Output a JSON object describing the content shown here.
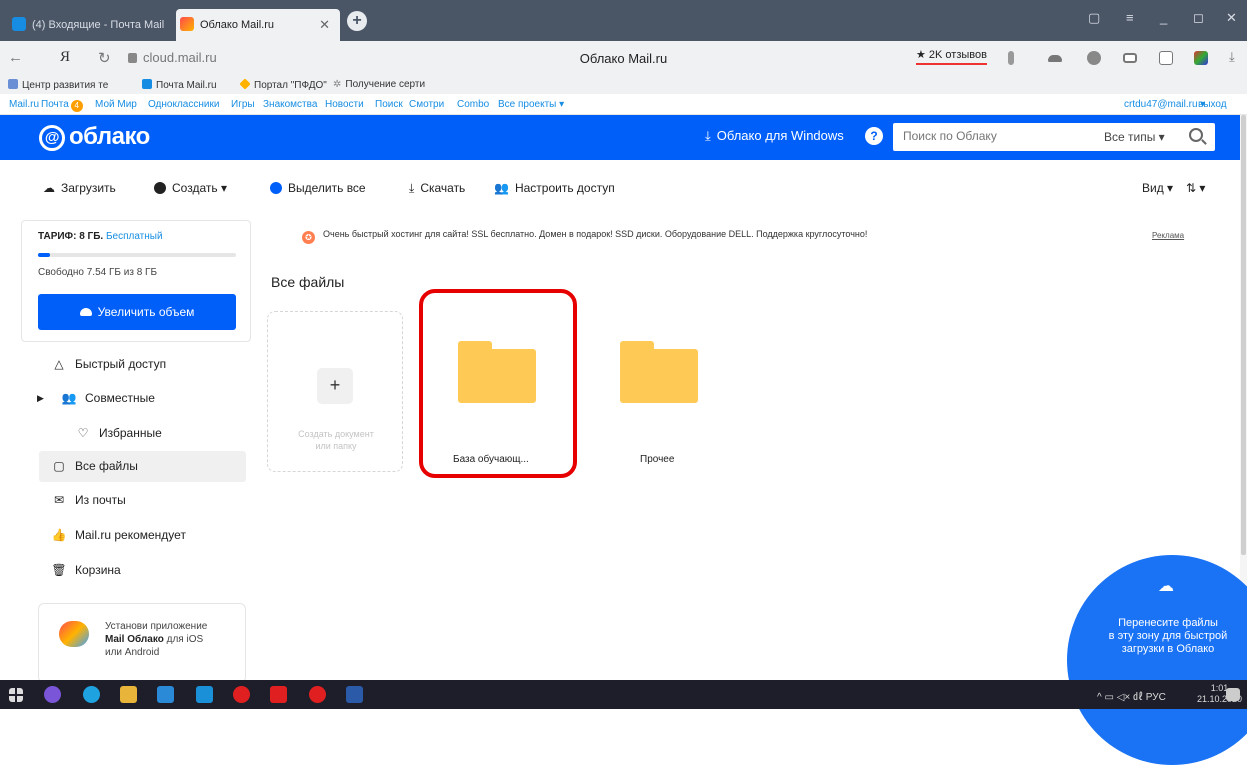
{
  "browser": {
    "tabs": [
      {
        "label": "(4) Входящие - Почта Mail",
        "active": false
      },
      {
        "label": "Облако Mail.ru",
        "active": true
      }
    ],
    "new_tab_symbol": "+",
    "window_controls": [
      "▢",
      "≡",
      "_",
      "◻",
      "✕"
    ],
    "url": "cloud.mail.ru",
    "page_title": "Облако Mail.ru",
    "reviews": "★ 2K отзывов",
    "nav": {
      "back": "←",
      "yandex": "Я",
      "reload": "↻"
    },
    "bookmarks": [
      "Центр развития те",
      "Почта Mail.ru",
      "Портал \"ПФДО\"",
      "Получение серти"
    ]
  },
  "portal": {
    "links": [
      "Mail.ru",
      "Почта",
      "Мой Мир",
      "Одноклассники",
      "Игры",
      "Знакомства",
      "Новости",
      "Поиск",
      "Смотри",
      "Combo",
      "Все проекты ▾"
    ],
    "mail_badge": "4",
    "user_email": "crtdu47@mail.ru ▾",
    "logout": "выход"
  },
  "header": {
    "logo_text": "облако",
    "logo_at": "@",
    "windows_link": "Облако для Windows",
    "help": "?",
    "search_placeholder": "Поиск по Облаку",
    "search_types": "Все типы ▾"
  },
  "toolbar": {
    "upload": "Загрузить",
    "create": "Создать ▾",
    "select_all": "Выделить все",
    "download": "Скачать",
    "share": "Настроить доступ",
    "view": "Вид ▾",
    "sort": "⇅ ▾"
  },
  "sidebar": {
    "tariff_label": "ТАРИФ: 8 ГБ.",
    "tariff_plan": "Бесплатный",
    "quota_used_fraction": 0.06,
    "free_space": "Свободно 7.54 ГБ из 8 ГБ",
    "upgrade_button": "Увеличить объем",
    "items": [
      {
        "label": "Быстрый доступ",
        "icon": "△"
      },
      {
        "label": "Совместные",
        "icon": "👥"
      },
      {
        "label": "Избранные",
        "icon": "♡"
      },
      {
        "label": "Все файлы",
        "icon": "▢"
      },
      {
        "label": "Из почты",
        "icon": "✉"
      },
      {
        "label": "Mail.ru рекомендует",
        "icon": "👍"
      },
      {
        "label": "Корзина",
        "icon": "🗑"
      }
    ],
    "promo": {
      "line1": "Установи приложение",
      "line2_bold": "Mail Облако",
      "line2_rest": " для iOS",
      "line3": "или Android"
    }
  },
  "main": {
    "ad_text": "Очень быстрый хостинг для сайта!   SSL бесплатно. Домен в подарок! SSD диски. Оборудование DELL. Поддержка круглосуточно!",
    "ad_label": "Реклама",
    "heading": "Все файлы",
    "create_card": {
      "plus": "+",
      "line1": "Создать документ",
      "line2": "или папку"
    },
    "folders": [
      {
        "name": "База обучающ..."
      },
      {
        "name": "Прочее"
      }
    ]
  },
  "dropzone": {
    "line1": "Перенесите файлы",
    "line2": "в эту зону для быстрой",
    "line3": "загрузки в Облако"
  },
  "taskbar": {
    "tray_text": "^  ▭ ◁×  ㎗  РУС",
    "time": "1:01",
    "date": "21.10.2020"
  },
  "colors": {
    "brand_blue": "#005ff9",
    "folder_yellow": "#ffc955",
    "highlight_red": "#e60000"
  }
}
